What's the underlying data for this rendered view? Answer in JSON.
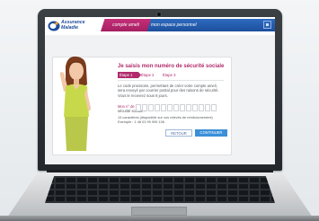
{
  "header": {
    "logo_text_line1": "Assurance",
    "logo_text_line2": "Maladie",
    "tab_compte": "compte ameli",
    "tab_espace": "mon espace personnel"
  },
  "form": {
    "title": "Je saisis mon numéro de sécurité sociale",
    "steps": [
      "Étape 1",
      "Étape 2",
      "Étape 3"
    ],
    "paragraph": "Le code provisoire, permettant de créer votre compte ameli, sera envoyé par courrier postal pour des raisons de sécurité. Vous le recevrez sous 8 jours.",
    "field_label_line1": "Mon n° de",
    "field_label_line2": "sécurité sociale :",
    "digit_count": 13,
    "hint_line1": "13 caractères (disponible sur vos relevés de remboursement)",
    "hint_line2": "Exemple : 1 48 03 99 999 106",
    "button_back": "RETOUR",
    "button_continue": "CONTINUER"
  },
  "colors": {
    "brand_blue": "#1d4f9c",
    "accent_magenta": "#b02a6c",
    "continue_button": "#3a8fd8"
  }
}
